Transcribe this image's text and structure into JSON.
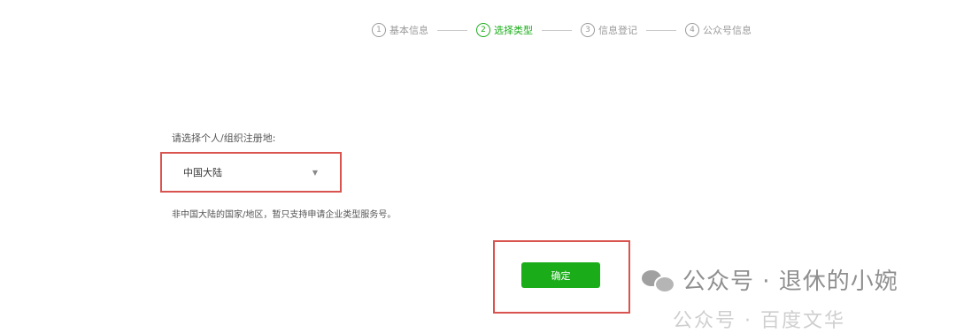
{
  "steps": [
    {
      "num": "1",
      "label": "基本信息"
    },
    {
      "num": "2",
      "label": "选择类型"
    },
    {
      "num": "3",
      "label": "信息登记"
    },
    {
      "num": "4",
      "label": "公众号信息"
    }
  ],
  "active_step": 2,
  "form": {
    "region_label": "请选择个人/组织注册地:",
    "region_value": "中国大陆",
    "region_note": "非中国大陆的国家/地区，暂只支持申请企业类型服务号。",
    "confirm_label": "确定"
  },
  "watermark": {
    "text": "公众号 · 退休的小婉",
    "faded_text": "公众号 · 百度文华"
  },
  "colors": {
    "accent": "#1aad19",
    "highlight": "#d9534f",
    "muted": "#9a9a9a"
  },
  "icons": {
    "dropdown": "caret-down-icon",
    "watermark": "wechat-icon"
  }
}
